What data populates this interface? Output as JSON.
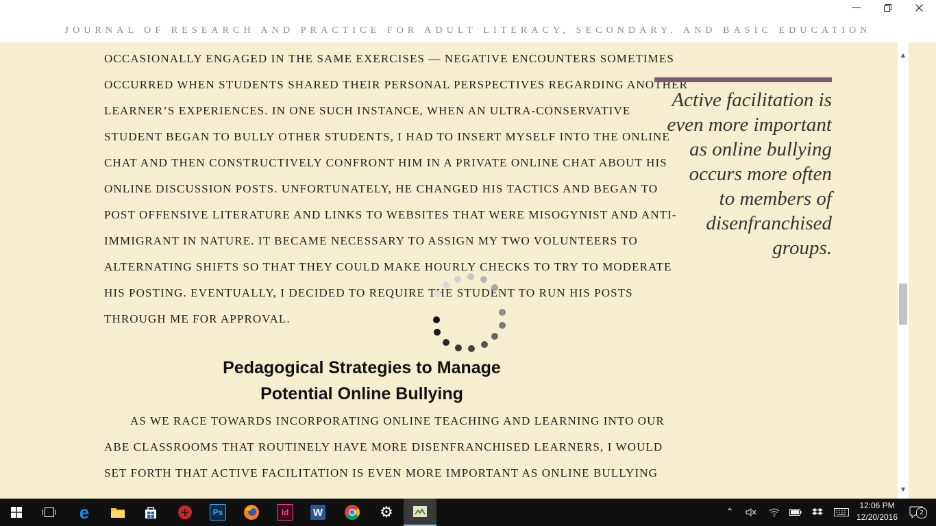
{
  "window": {
    "header": "JOURNAL OF RESEARCH AND PRACTICE FOR ADULT LITERACY, SECONDARY, AND BASIC EDUCATION",
    "minimize_icon": "minimize-icon",
    "restore_icon": "restore-icon",
    "close_icon": "close-icon"
  },
  "document": {
    "paragraph1_lines": [
      "OCCASIONALLY ENGAGED IN THE SAME EXERCISES — NEGATIVE ENCOUNTERS SOMETIMES",
      "OCCURRED WHEN STUDENTS SHARED THEIR PERSONAL PERSPECTIVES REGARDING ANOTHER",
      "LEARNER’S EXPERIENCES. IN ONE SUCH INSTANCE, WHEN AN ULTRA-CONSERVATIVE",
      "STUDENT BEGAN TO BULLY OTHER STUDENTS, I HAD TO INSERT MYSELF INTO THE ONLINE",
      "CHAT AND THEN CONSTRUCTIVELY CONFRONT HIM IN A PRIVATE ONLINE CHAT ABOUT HIS",
      "ONLINE DISCUSSION POSTS. UNFORTUNATELY, HE CHANGED HIS TACTICS AND BEGAN TO",
      "POST OFFENSIVE LITERATURE AND LINKS TO WEBSITES THAT WERE MISOGYNIST AND ANTI-",
      "IMMIGRANT IN NATURE. IT BECAME NECESSARY TO ASSIGN MY TWO VOLUNTEERS TO",
      "ALTERNATING SHIFTS SO THAT THEY COULD MAKE HOURLY CHECKS TO TRY TO MODERATE",
      "HIS POSTING. EVENTUALLY, I DECIDED TO REQUIRE THE STUDENT TO RUN HIS POSTS",
      "THROUGH ME FOR APPROVAL."
    ],
    "heading_line1": "Pedagogical Strategies to Manage",
    "heading_line2": "Potential Online Bullying",
    "paragraph2_lines": [
      "AS WE RACE TOWARDS INCORPORATING ONLINE TEACHING AND LEARNING INTO OUR",
      "ABE CLASSROOMS THAT ROUTINELY HAVE MORE DISENFRANCHISED LEARNERS, I WOULD",
      "SET FORTH THAT ACTIVE FACILITATION IS EVEN MORE IMPORTANT AS ONLINE BULLYING"
    ],
    "pullquote_lines": [
      "Active facilitation is",
      "even more important",
      "as online bullying",
      "occurs more often",
      "to members of",
      "disenfranchised",
      "groups."
    ],
    "accent_color": "#7d5a72",
    "background_color": "#f5efcf"
  },
  "taskbar": {
    "apps": [
      {
        "name": "start-button",
        "icon": "windows-logo-icon"
      },
      {
        "name": "task-view-button",
        "icon": "task-view-icon"
      },
      {
        "name": "edge-button",
        "icon": "edge-icon",
        "label": "e"
      },
      {
        "name": "file-explorer-button",
        "icon": "folder-icon"
      },
      {
        "name": "store-button",
        "icon": "store-icon"
      },
      {
        "name": "app-red-button",
        "icon": "red-app-icon"
      },
      {
        "name": "photoshop-button",
        "icon": "photoshop-icon",
        "label": "Ps"
      },
      {
        "name": "firefox-button",
        "icon": "firefox-icon"
      },
      {
        "name": "indesign-button",
        "icon": "indesign-icon",
        "label": "Id"
      },
      {
        "name": "word-button",
        "icon": "word-icon",
        "label": "W"
      },
      {
        "name": "chrome-button",
        "icon": "chrome-icon"
      },
      {
        "name": "settings-button",
        "icon": "gear-icon"
      },
      {
        "name": "reader-app-button",
        "icon": "reader-app-icon"
      }
    ],
    "tray": {
      "time": "12:06 PM",
      "date": "12/20/2016",
      "notification_count": "2"
    }
  }
}
